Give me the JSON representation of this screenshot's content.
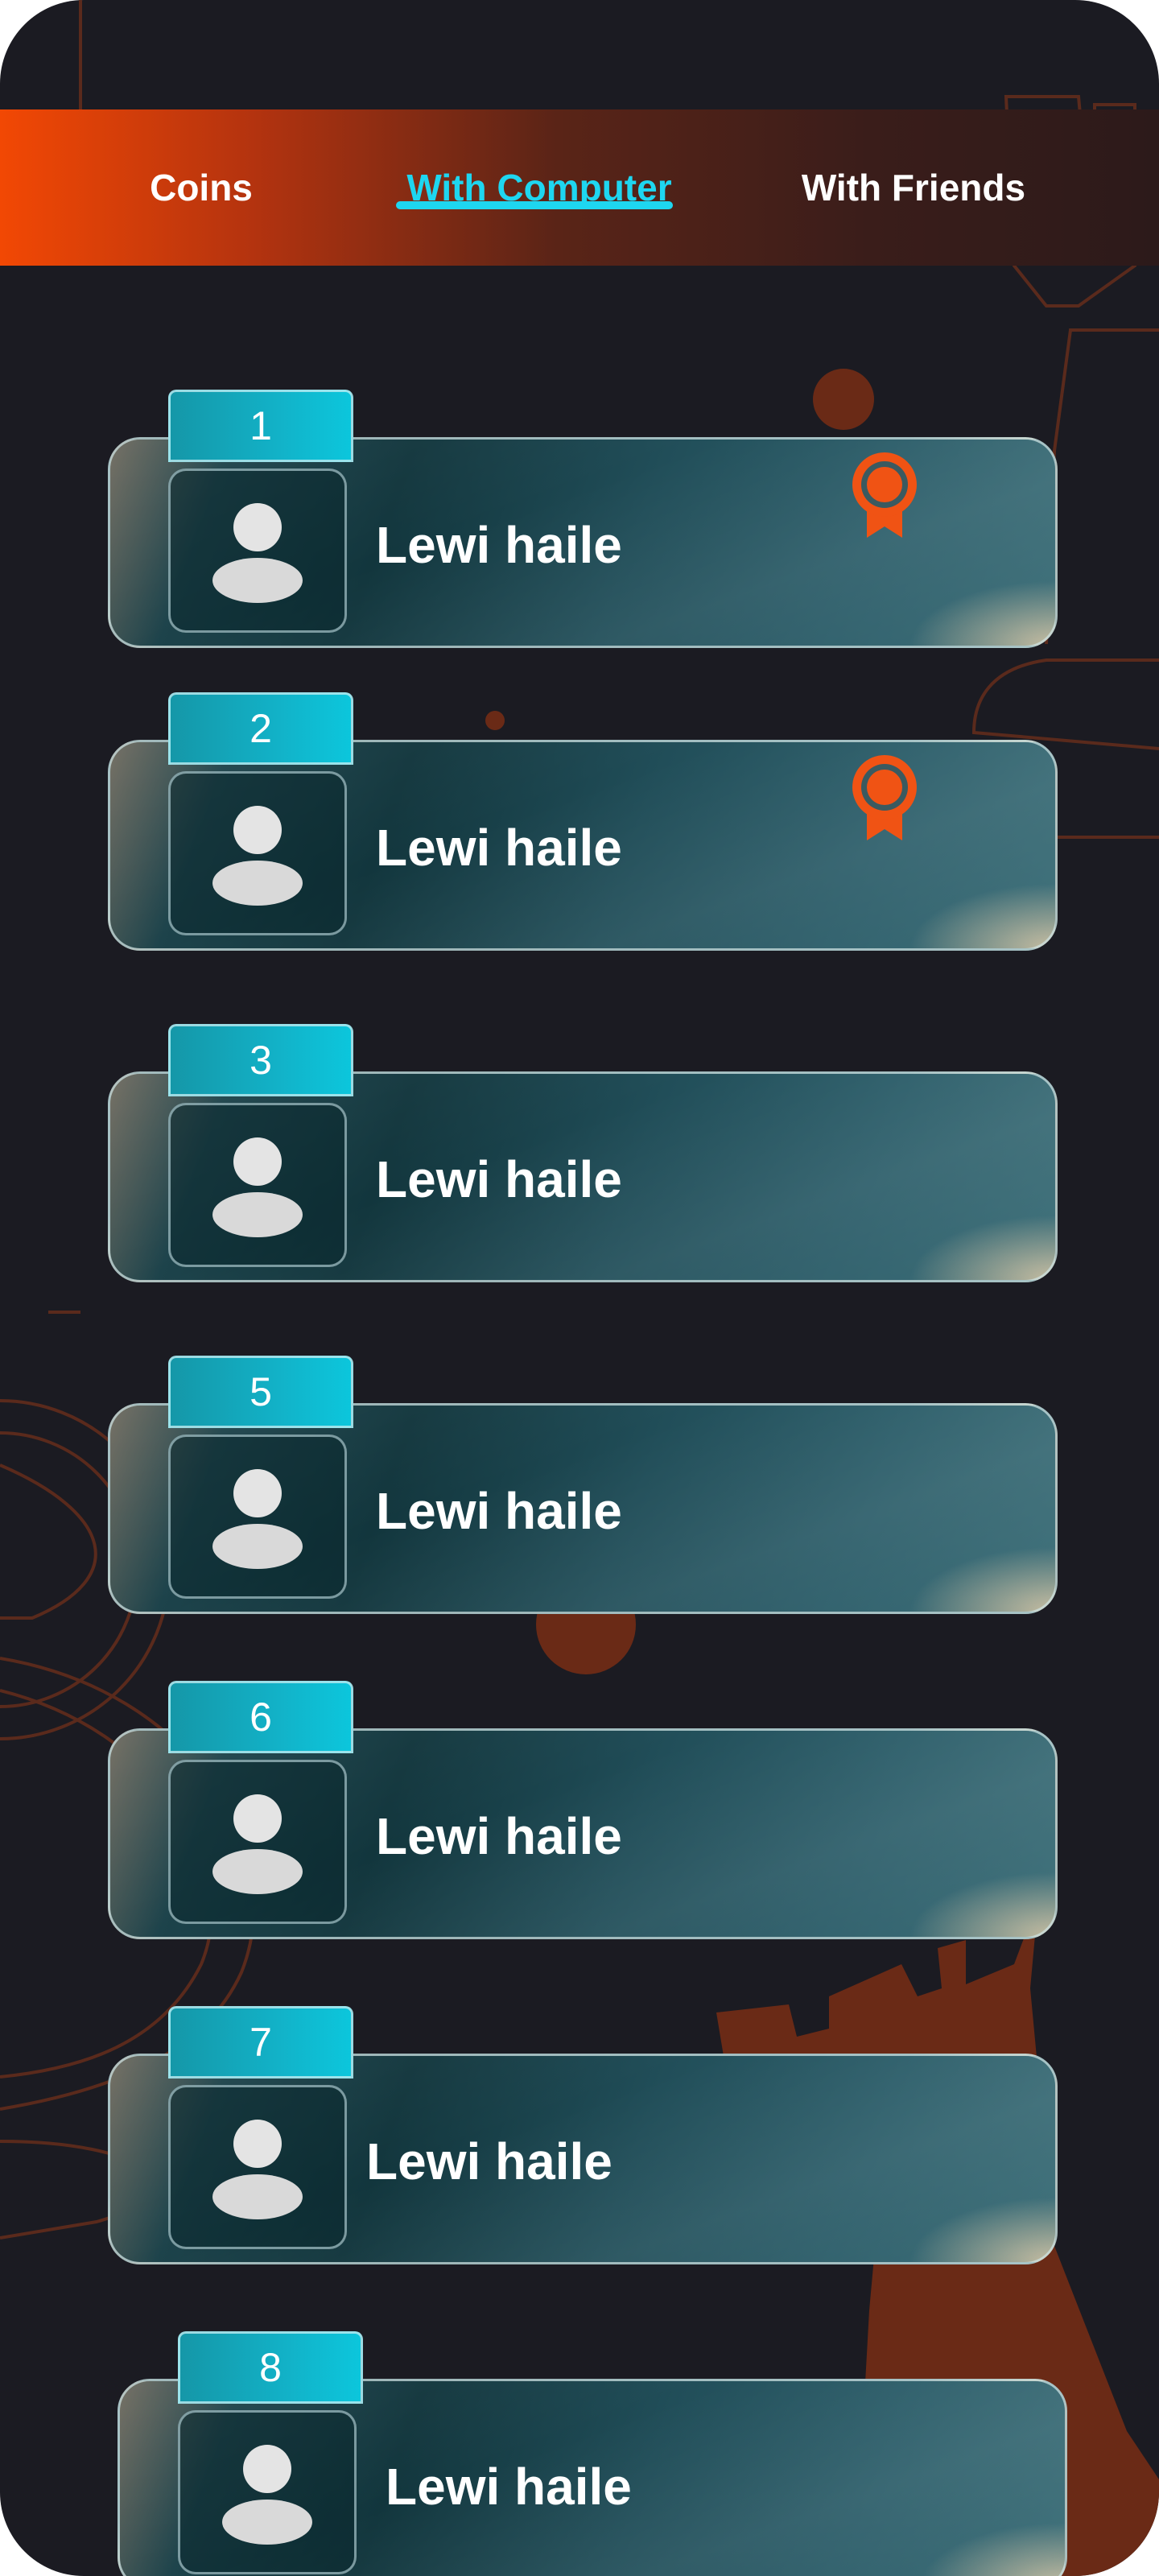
{
  "tabs": [
    {
      "label": "Coins",
      "active": false
    },
    {
      "label": "With Computer",
      "active": true
    },
    {
      "label": "With Friends",
      "active": false
    }
  ],
  "colors": {
    "accent_cyan": "#1ed6f0",
    "accent_orange": "#f05314",
    "background": "#1b1b22"
  },
  "icons": {
    "avatar": "user-avatar-icon",
    "medal": "award-medal-icon"
  },
  "leaderboard": [
    {
      "rank": "1",
      "name": "Lewi haile",
      "medal": true
    },
    {
      "rank": "2",
      "name": "Lewi haile",
      "medal": true
    },
    {
      "rank": "3",
      "name": "Lewi haile",
      "medal": false
    },
    {
      "rank": "5",
      "name": "Lewi haile",
      "medal": false
    },
    {
      "rank": "6",
      "name": "Lewi haile",
      "medal": false
    },
    {
      "rank": "7",
      "name": "Lewi haile",
      "medal": false
    },
    {
      "rank": "8",
      "name": "Lewi haile",
      "medal": false
    }
  ]
}
